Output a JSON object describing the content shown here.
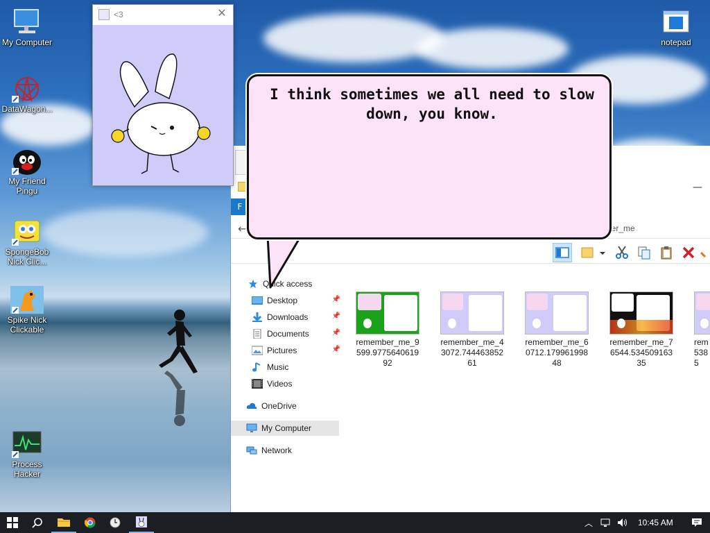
{
  "desktop": {
    "icons": [
      {
        "label": "My Computer",
        "icon": "monitor-icon"
      },
      {
        "label": "DataWagon...",
        "icon": "datawagon-icon"
      },
      {
        "label": "My Friend Pingu",
        "icon": "pingu-icon"
      },
      {
        "label": "SpongeBob Nick Clic...",
        "icon": "spongebob-icon"
      },
      {
        "label": "Spike Nick Clickable",
        "icon": "spike-icon"
      },
      {
        "label": "Process Hacker",
        "icon": "process-hacker-icon"
      },
      {
        "label": "notepad",
        "icon": "notepad-icon"
      }
    ]
  },
  "pet_window": {
    "title": "<3",
    "close_glyph": "✕",
    "bg_color": "#cfccf9"
  },
  "speech_bubble": {
    "text": "I think sometimes we all need to slow down, you know.",
    "bg_color": "#fde3f8"
  },
  "explorer": {
    "file_tab": "F",
    "minimize_glyph": "—",
    "back_glyph": "←",
    "address_crumb": "ber_me",
    "nav": {
      "quick_access": "Quick access",
      "items": [
        {
          "label": "Desktop",
          "icon": "desktop-folder-icon",
          "pinned": true
        },
        {
          "label": "Downloads",
          "icon": "downloads-icon",
          "pinned": true
        },
        {
          "label": "Documents",
          "icon": "documents-icon",
          "pinned": true
        },
        {
          "label": "Pictures",
          "icon": "pictures-icon",
          "pinned": true
        },
        {
          "label": "Music",
          "icon": "music-icon",
          "pinned": false
        },
        {
          "label": "Videos",
          "icon": "videos-icon",
          "pinned": false
        }
      ],
      "onedrive": "OneDrive",
      "my_computer": "My Computer",
      "network": "Network"
    },
    "files": [
      {
        "name": "remember_me_9599.977564061992",
        "thumb_bg": "#1aa31a"
      },
      {
        "name": "remember_me_43072.74446385261",
        "thumb_bg": "#cfccf9"
      },
      {
        "name": "remember_me_60712.17996199848",
        "thumb_bg": "#cfccf9"
      },
      {
        "name": "remember_me_76544.53450916335",
        "thumb_bg": "#111111"
      },
      {
        "name": "rem 5385",
        "thumb_bg": "#cfccf9"
      }
    ]
  },
  "taskbar": {
    "time": "10:45 AM"
  }
}
